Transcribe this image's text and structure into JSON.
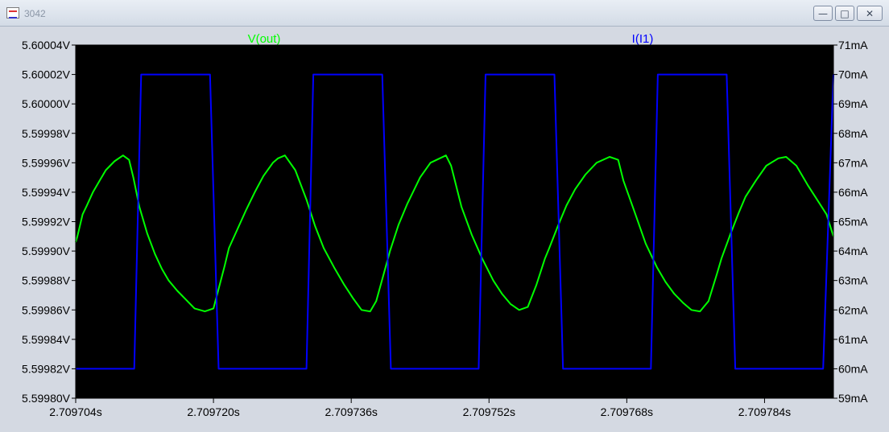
{
  "window": {
    "title": "3042",
    "icon": "waveform-icon",
    "buttons": {
      "minimize": "minimize-icon",
      "maximize": "maximize-icon",
      "close": "close-icon"
    }
  },
  "colors": {
    "background": "#000000",
    "frame": "#d4d9e2",
    "axis": "#000000",
    "voltage": "#00ff00",
    "current": "#0000ff"
  },
  "chart_data": {
    "type": "line",
    "x_ticks": [
      "2.709704s",
      "2.709720s",
      "2.709736s",
      "2.709752s",
      "2.709768s",
      "2.709784s"
    ],
    "y_left_ticks": [
      "5.59980V",
      "5.59982V",
      "5.59984V",
      "5.59986V",
      "5.59988V",
      "5.59990V",
      "5.59992V",
      "5.59994V",
      "5.59996V",
      "5.59998V",
      "5.60000V",
      "5.60002V",
      "5.60004V"
    ],
    "y_right_ticks": [
      "59mA",
      "60mA",
      "61mA",
      "62mA",
      "63mA",
      "64mA",
      "65mA",
      "66mA",
      "67mA",
      "68mA",
      "69mA",
      "70mA",
      "71mA"
    ],
    "x_unit": "s",
    "xlim": [
      2.709704,
      2.709792
    ],
    "y_left_lim": [
      5.5998,
      5.60004
    ],
    "y_right_lim": [
      59,
      71
    ],
    "grid": false,
    "series": [
      {
        "name": "V(out)",
        "axis": "left",
        "color": "#00ff00",
        "x": [
          2.709704,
          2.7097042,
          2.7097044,
          2.7097048,
          2.7097053,
          2.709706,
          2.7097068,
          2.7097075,
          2.7097085,
          2.7097095,
          2.7097102,
          2.7097107,
          2.7097114,
          2.7097123,
          2.7097132,
          2.709714,
          2.7097148,
          2.7097158,
          2.7097168,
          2.7097178,
          2.709719,
          2.70972,
          2.7097205,
          2.7097213,
          2.7097218,
          2.7097228,
          2.7097238,
          2.7097248,
          2.7097258,
          2.7097269,
          2.7097275,
          2.7097283,
          2.7097295,
          2.7097308,
          2.7097318,
          2.7097328,
          2.709734,
          2.7097352,
          2.7097362,
          2.7097372,
          2.7097382,
          2.7097389,
          2.7097398,
          2.7097405,
          2.7097415,
          2.7097425,
          2.709744,
          2.7097452,
          2.709747,
          2.7097476,
          2.7097488,
          2.70975,
          2.7097512,
          2.7097525,
          2.7097535,
          2.7097545,
          2.7097555,
          2.7097565,
          2.7097575,
          2.7097585,
          2.709759,
          2.70976,
          2.709761,
          2.709762,
          2.7097632,
          2.7097645,
          2.709766,
          2.709767,
          2.7097676,
          2.709769,
          2.7097702,
          2.7097715,
          2.7097725,
          2.7097735,
          2.7097745,
          2.7097755,
          2.7097765,
          2.7097775,
          2.7097785,
          2.709779,
          2.70978,
          2.709781,
          2.7097818,
          2.709783,
          2.7097842,
          2.7097856,
          2.7097865,
          2.7097877,
          2.709789,
          2.7097912,
          2.709792
        ],
        "y": [
          5.599906,
          5.59991,
          5.599915,
          5.599925,
          5.599931,
          5.59994,
          5.599948,
          5.599955,
          5.599961,
          5.599965,
          5.599962,
          5.59995,
          5.59993,
          5.599912,
          5.599898,
          5.599888,
          5.59988,
          5.599873,
          5.599867,
          5.599861,
          5.599859,
          5.599861,
          5.599872,
          5.59989,
          5.599902,
          5.599915,
          5.599928,
          5.59994,
          5.599951,
          5.59996,
          5.599963,
          5.599965,
          5.599955,
          5.599935,
          5.599917,
          5.599902,
          5.599889,
          5.599877,
          5.599868,
          5.59986,
          5.599859,
          5.599866,
          5.599885,
          5.5999,
          5.599918,
          5.599932,
          5.59995,
          5.59996,
          5.599965,
          5.599958,
          5.59993,
          5.599911,
          5.599895,
          5.59988,
          5.599871,
          5.599864,
          5.59986,
          5.599862,
          5.599877,
          5.599895,
          5.599902,
          5.599917,
          5.599931,
          5.599942,
          5.599952,
          5.59996,
          5.599964,
          5.599962,
          5.599948,
          5.599925,
          5.599905,
          5.599889,
          5.599879,
          5.599871,
          5.599865,
          5.59986,
          5.599859,
          5.599866,
          5.599885,
          5.599895,
          5.599911,
          5.599926,
          5.599937,
          5.599948,
          5.599958,
          5.599963,
          5.599964,
          5.599958,
          5.599945,
          5.599925,
          5.59991
        ]
      },
      {
        "name": "I(I1)",
        "axis": "right",
        "color": "#0000ff",
        "x": [
          2.709704,
          2.7097108,
          2.7097116,
          2.7097196,
          2.7097206,
          2.7097308,
          2.7097316,
          2.7097396,
          2.7097406,
          2.7097508,
          2.7097516,
          2.7097596,
          2.7097606,
          2.7097708,
          2.7097716,
          2.7097796,
          2.7097806,
          2.7097908,
          2.709792
        ],
        "y": [
          60,
          60,
          70,
          70,
          60,
          60,
          70,
          70,
          60,
          60,
          70,
          70,
          60,
          60,
          70,
          70,
          60,
          60,
          70
        ]
      }
    ]
  }
}
